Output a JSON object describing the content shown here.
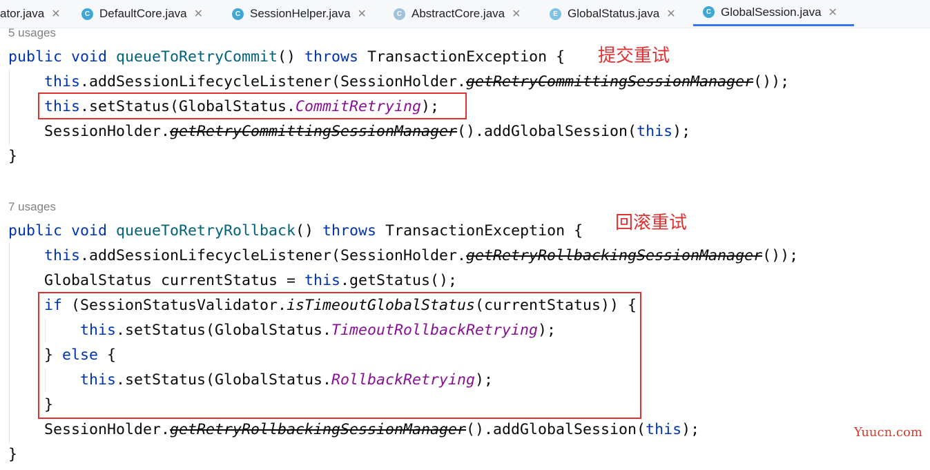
{
  "tabs": [
    {
      "label": "ator.java",
      "icon": "",
      "active": false
    },
    {
      "label": "DefaultCore.java",
      "icon": "C",
      "active": false
    },
    {
      "label": "SessionHelper.java",
      "icon": "C",
      "active": false
    },
    {
      "label": "AbstractCore.java",
      "icon": "C",
      "active": false
    },
    {
      "label": "GlobalStatus.java",
      "icon": "E",
      "active": false
    },
    {
      "label": "GlobalSession.java",
      "icon": "C",
      "active": true
    }
  ],
  "close_glyph": "✕",
  "usages": [
    "5 usages",
    "7 usages"
  ],
  "annotations": {
    "commit_retry": "提交重试",
    "rollback_retry": "回滚重试"
  },
  "watermark": "Yuucn.com",
  "code": {
    "m1_sig": {
      "kw1": "public void ",
      "name": "queueToRetryCommit",
      "p": "() ",
      "kw2": "throws",
      "rest": " TransactionException {"
    },
    "m1_l1": {
      "this": "this",
      "a": ".addSessionLifecycleListener(SessionHolder.",
      "s": "getRetryCommittingSessionManager",
      "b": "());"
    },
    "m1_l2": {
      "this": "this",
      "a": ".setStatus(GlobalStatus.",
      "c": "CommitRetrying",
      "b": ");"
    },
    "m1_l3": {
      "a": "SessionHolder.",
      "s": "getRetryCommittingSessionManager",
      "b": "().addGlobalSession(",
      "this": "this",
      "e": ");"
    },
    "close": "}",
    "m2_sig": {
      "kw1": "public void ",
      "name": "queueToRetryRollback",
      "p": "() ",
      "kw2": "throws",
      "rest": " TransactionException {"
    },
    "m2_l1": {
      "this": "this",
      "a": ".addSessionLifecycleListener(SessionHolder.",
      "s": "getRetryRollbackingSessionManager",
      "b": "());"
    },
    "m2_l2": {
      "a": "GlobalStatus currentStatus = ",
      "this": "this",
      "b": ".getStatus();"
    },
    "m2_l3": {
      "kw": "if",
      "a": " (SessionStatusValidator.",
      "i": "isTimeoutGlobalStatus",
      "b": "(currentStatus)) {"
    },
    "m2_l4": {
      "this": "this",
      "a": ".setStatus(GlobalStatus.",
      "c": "TimeoutRollbackRetrying",
      "b": ");"
    },
    "m2_l5": {
      "a": "} ",
      "kw": "else",
      "b": " {"
    },
    "m2_l6": {
      "this": "this",
      "a": ".setStatus(GlobalStatus.",
      "c": "RollbackRetrying",
      "b": ");"
    },
    "m2_l8": {
      "a": "SessionHolder.",
      "s": "getRetryRollbackingSessionManager",
      "b": "().addGlobalSession(",
      "this": "this",
      "e": ");"
    }
  }
}
